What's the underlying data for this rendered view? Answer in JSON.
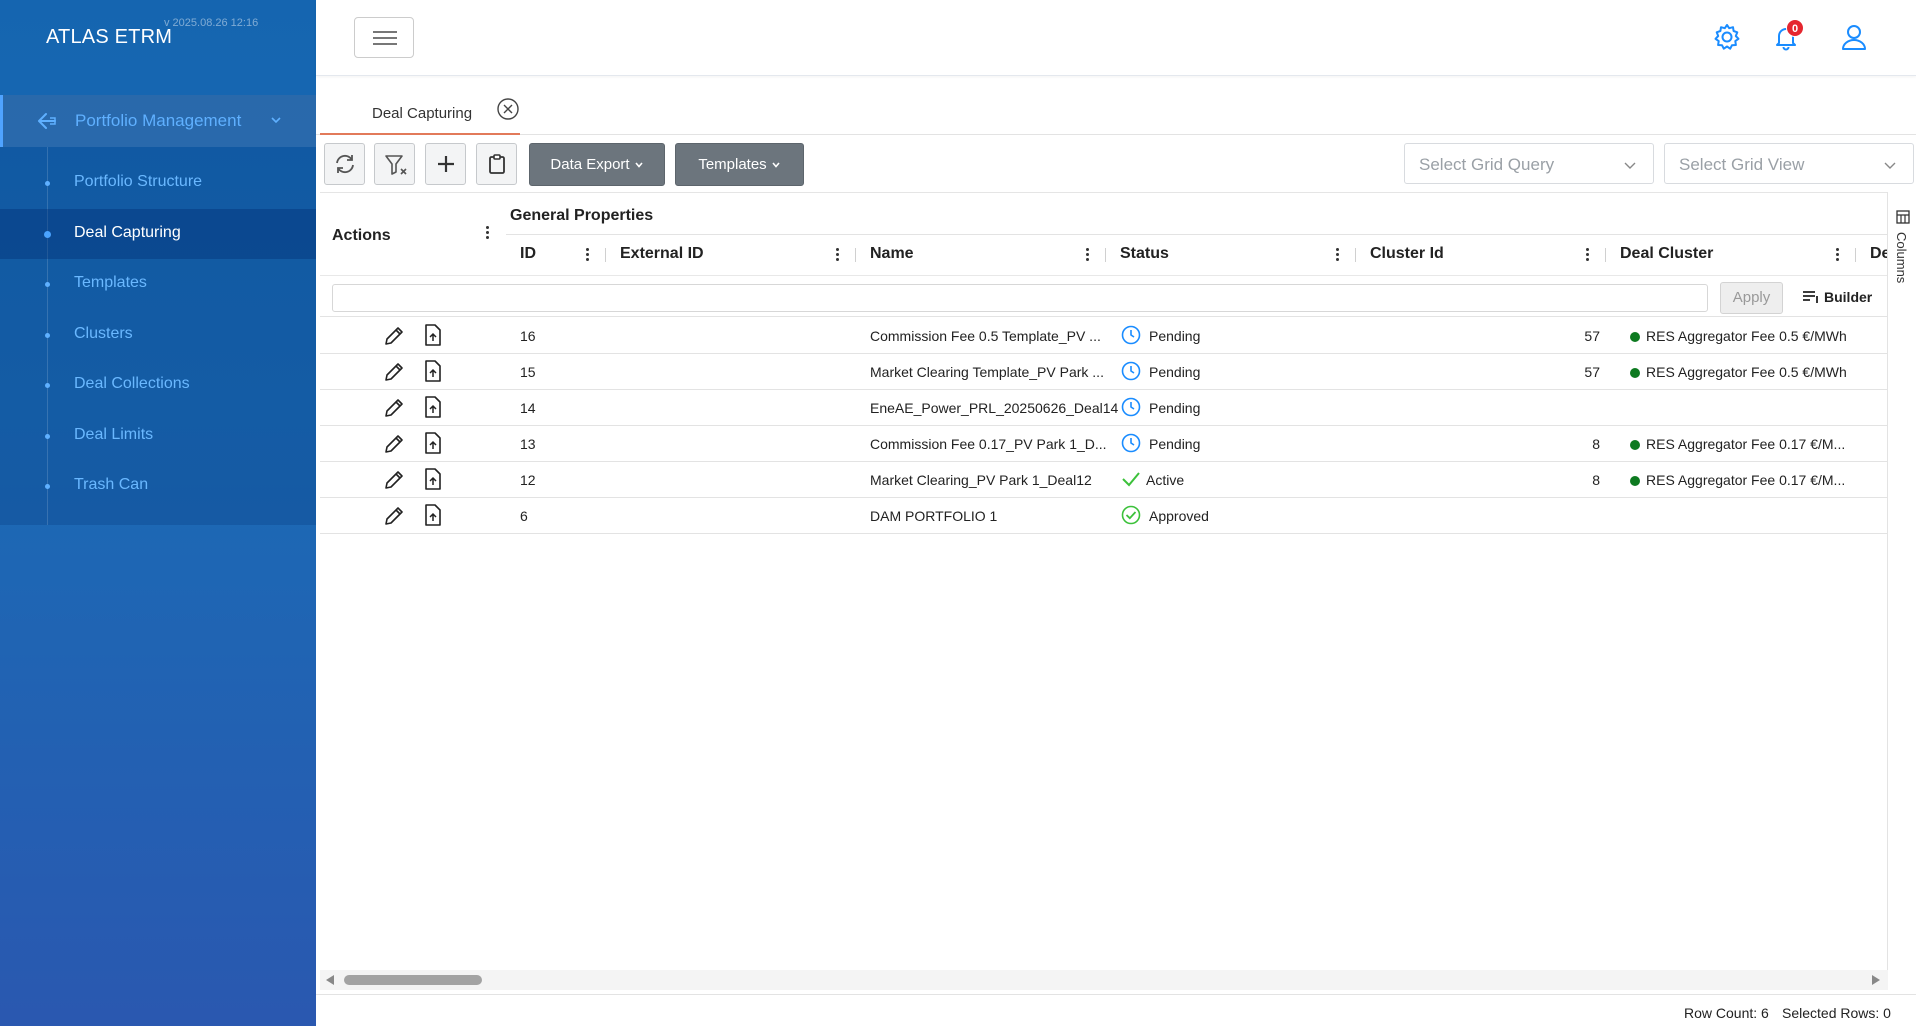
{
  "app": {
    "brand": "ATLAS ETRM",
    "version": "v 2025.08.26 12:16"
  },
  "sidebar": {
    "parent": {
      "label": "Portfolio Management",
      "icon": "back-arrow-icon"
    },
    "items": [
      {
        "label": "Portfolio Structure",
        "active": false
      },
      {
        "label": "Deal Capturing",
        "active": true
      },
      {
        "label": "Templates",
        "active": false
      },
      {
        "label": "Clusters",
        "active": false
      },
      {
        "label": "Deal Collections",
        "active": false
      },
      {
        "label": "Deal Limits",
        "active": false
      },
      {
        "label": "Trash Can",
        "active": false
      }
    ]
  },
  "topbar": {
    "notification_count": "0",
    "icons": [
      "menu-icon",
      "gear-icon",
      "bell-icon",
      "user-icon"
    ]
  },
  "tabs": [
    {
      "label": "Deal Capturing"
    }
  ],
  "toolbar": {
    "data_export_label": "Data Export",
    "templates_label": "Templates",
    "grid_query_placeholder": "Select Grid Query",
    "grid_view_placeholder": "Select Grid View"
  },
  "grid": {
    "actions_header": "Actions",
    "group_header": "General Properties",
    "columns": [
      "ID",
      "External ID",
      "Name",
      "Status",
      "Cluster Id",
      "Deal Cluster",
      "De"
    ],
    "apply_label": "Apply",
    "builder_label": "Builder",
    "side_panel_label": "Columns",
    "rows": [
      {
        "id": "16",
        "external_id": "",
        "name": "Commission Fee 0.5 Template_PV ...",
        "status": "Pending",
        "cluster_id": "57",
        "deal_cluster": "RES Aggregator Fee 0.5 €/MWh"
      },
      {
        "id": "15",
        "external_id": "",
        "name": "Market Clearing Template_PV Park ...",
        "status": "Pending",
        "cluster_id": "57",
        "deal_cluster": "RES Aggregator Fee 0.5 €/MWh"
      },
      {
        "id": "14",
        "external_id": "",
        "name": "EneAE_Power_PRL_20250626_Deal14",
        "status": "Pending",
        "cluster_id": "",
        "deal_cluster": ""
      },
      {
        "id": "13",
        "external_id": "",
        "name": "Commission Fee 0.17_PV Park 1_D...",
        "status": "Pending",
        "cluster_id": "8",
        "deal_cluster": "RES Aggregator Fee 0.17 €/M..."
      },
      {
        "id": "12",
        "external_id": "",
        "name": "Market Clearing_PV Park 1_Deal12",
        "status": "Active",
        "cluster_id": "8",
        "deal_cluster": "RES Aggregator Fee 0.17 €/M..."
      },
      {
        "id": "6",
        "external_id": "",
        "name": "DAM PORTFOLIO 1",
        "status": "Approved",
        "cluster_id": "",
        "deal_cluster": ""
      }
    ]
  },
  "statusbar": {
    "row_count": "Row Count: 6",
    "selected_rows": "Selected Rows: 0"
  },
  "colors": {
    "accent": "#1a8cff",
    "status_pending": "#1a8cff",
    "status_active": "#3cc13b",
    "status_approved": "#3cc13b",
    "cluster_dot": "#0d7a20",
    "badge": "#e5262f"
  }
}
